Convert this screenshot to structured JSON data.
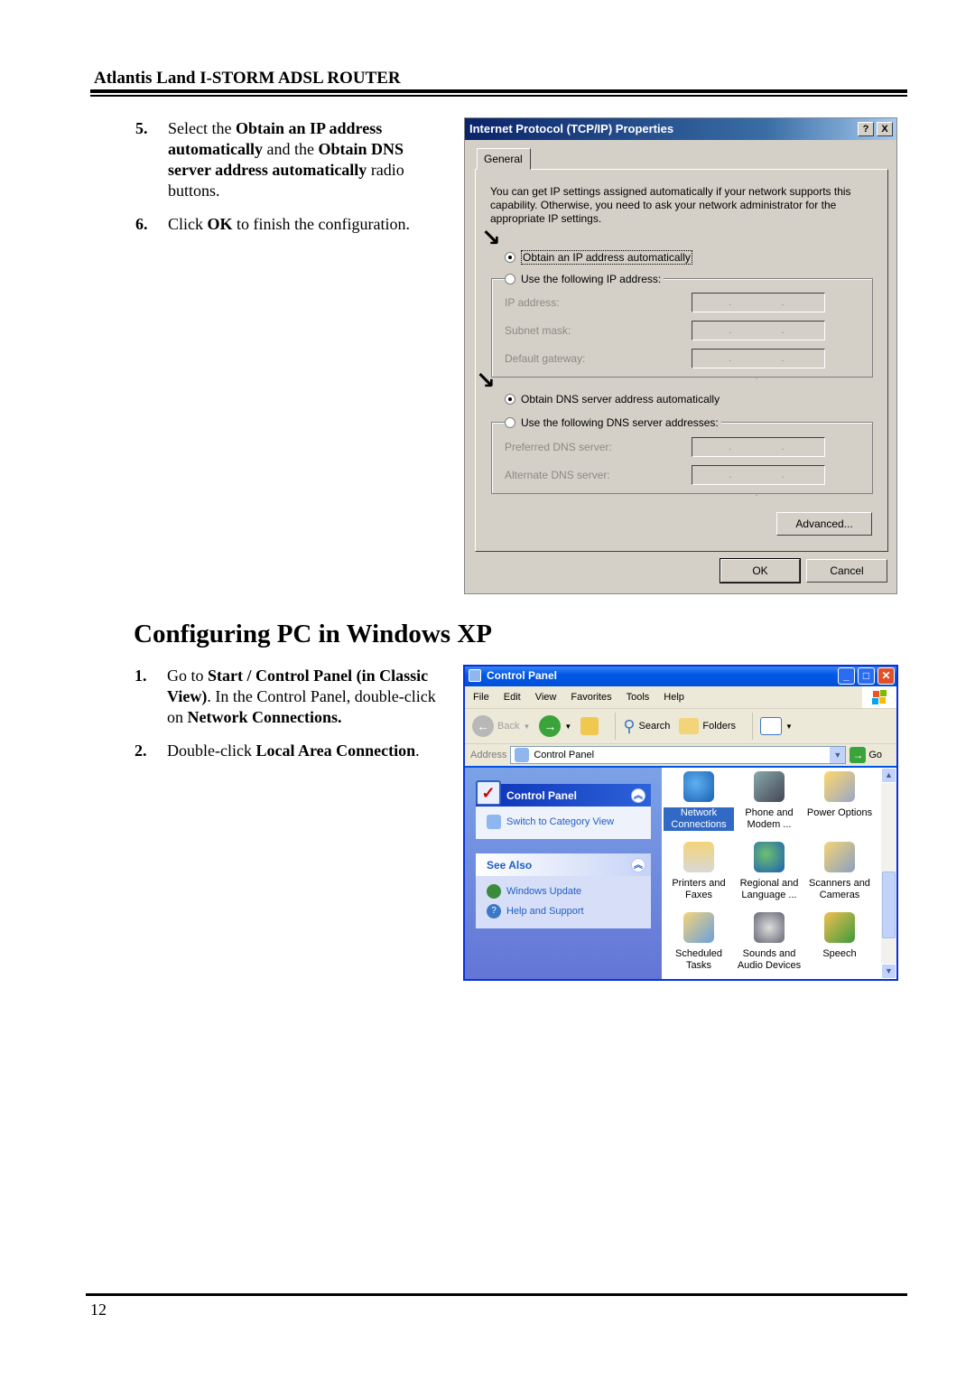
{
  "header": {
    "title": "Atlantis Land I-STORM ADSL ROUTER"
  },
  "steps_top": [
    {
      "num": "5.",
      "parts": [
        {
          "t": "Select the ",
          "b": false
        },
        {
          "t": "Obtain an IP address automatically",
          "b": true
        },
        {
          "t": " and the ",
          "b": false
        },
        {
          "t": "Obtain DNS server address automatically",
          "b": true
        },
        {
          "t": " radio buttons.",
          "b": false
        }
      ]
    },
    {
      "num": "6.",
      "parts": [
        {
          "t": "Click ",
          "b": false
        },
        {
          "t": "OK",
          "b": true
        },
        {
          "t": " to finish the configuration.",
          "b": false
        }
      ]
    }
  ],
  "tcpip_dialog": {
    "title": "Internet Protocol (TCP/IP) Properties",
    "help_btn": "?",
    "close_btn": "X",
    "tab": "General",
    "intro": "You can get IP settings assigned automatically if your network supports this capability. Otherwise, you need to ask your network administrator for the appropriate IP settings.",
    "radio_ip_auto": "Obtain an IP address automatically",
    "radio_ip_manual": "Use the following IP address:",
    "ip_fields": [
      {
        "label": "IP address:",
        "value": ". . ."
      },
      {
        "label": "Subnet mask:",
        "value": ". . ."
      },
      {
        "label": "Default gateway:",
        "value": ". . ."
      }
    ],
    "radio_dns_auto": "Obtain DNS server address automatically",
    "radio_dns_manual": "Use the following DNS server addresses:",
    "dns_fields": [
      {
        "label": "Preferred DNS server:",
        "value": ". . ."
      },
      {
        "label": "Alternate DNS server:",
        "value": ". . ."
      }
    ],
    "advanced_btn": "Advanced...",
    "ok_btn": "OK",
    "cancel_btn": "Cancel",
    "selected": {
      "ip": "auto",
      "dns": "auto"
    }
  },
  "section": {
    "heading": "Configuring PC in Windows XP"
  },
  "steps_bottom": [
    {
      "num": "1.",
      "parts": [
        {
          "t": "Go to ",
          "b": false
        },
        {
          "t": "Start / Control Panel (in Classic View)",
          "b": true
        },
        {
          "t": ". In the Control Panel, double-click on ",
          "b": false
        },
        {
          "t": "Network Connections.",
          "b": true
        }
      ]
    },
    {
      "num": "2.",
      "parts": [
        {
          "t": "Double-click ",
          "b": false
        },
        {
          "t": "Local Area Connection",
          "b": true
        },
        {
          "t": ".",
          "b": false
        }
      ]
    }
  ],
  "control_panel": {
    "title": "Control Panel",
    "window_buttons": {
      "minimize": "_",
      "maximize": "□",
      "close": "✕"
    },
    "menu": [
      "File",
      "Edit",
      "View",
      "Favorites",
      "Tools",
      "Help"
    ],
    "toolbar": {
      "back": "Back",
      "search": "Search",
      "folders": "Folders"
    },
    "address_label": "Address",
    "address_value": "Control Panel",
    "go_label": "Go",
    "side_panel": {
      "primary_title": "Control Panel",
      "primary_link": "Switch to Category View",
      "see_also_title": "See Also",
      "see_also_links": [
        "Windows Update",
        "Help and Support"
      ]
    },
    "items": [
      {
        "label": "Network Connections",
        "icon": "network-globe-icon",
        "selected": true
      },
      {
        "label": "Phone and Modem ...",
        "icon": "phone-modem-icon",
        "selected": false
      },
      {
        "label": "Power Options",
        "icon": "power-plug-icon",
        "selected": false
      },
      {
        "label": "Printers and Faxes",
        "icon": "printer-icon",
        "selected": false
      },
      {
        "label": "Regional and Language ...",
        "icon": "globe-stand-icon",
        "selected": false
      },
      {
        "label": "Scanners and Cameras",
        "icon": "scanner-camera-icon",
        "selected": false
      },
      {
        "label": "Scheduled Tasks",
        "icon": "clock-folder-icon",
        "selected": false
      },
      {
        "label": "Sounds and Audio Devices",
        "icon": "speaker-icon",
        "selected": false
      },
      {
        "label": "Speech",
        "icon": "speech-person-icon",
        "selected": false
      }
    ]
  },
  "footer": {
    "page_number": "12"
  }
}
